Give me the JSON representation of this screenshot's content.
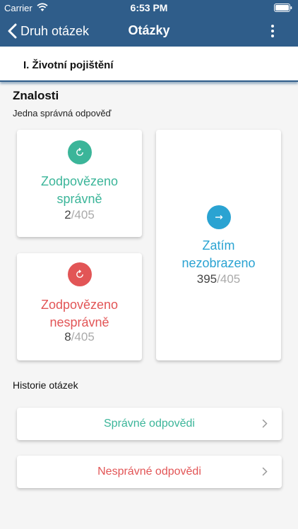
{
  "status_bar": {
    "carrier": "Carrier",
    "time": "6:53 PM"
  },
  "nav": {
    "back_label": "Druh otázek",
    "title": "Otázky"
  },
  "category": {
    "title": "I. Životní pojištění"
  },
  "section": {
    "title": "Znalosti",
    "subtitle": "Jedna správná odpověď"
  },
  "cards": {
    "correct": {
      "label_line1": "Zodpovězeno",
      "label_line2": "správně",
      "count": "2",
      "total": "/405"
    },
    "wrong": {
      "label_line1": "Zodpovězeno",
      "label_line2": "nesprávně",
      "count": "8",
      "total": "/405"
    },
    "unseen": {
      "label_line1": "Zatím",
      "label_line2": "nezobrazeno",
      "count": "395",
      "total": "/405"
    }
  },
  "history": {
    "title": "Historie otázek",
    "correct_label": "Správné odpovědi",
    "wrong_label": "Nesprávné odpovědi"
  },
  "colors": {
    "nav_bg": "#2f5d8a",
    "correct": "#3bb599",
    "wrong": "#e25556",
    "unseen": "#2aa3d2"
  },
  "icons": {
    "back": "chevron-left-icon",
    "more": "more-vertical-icon",
    "correct": "refresh-icon",
    "wrong": "refresh-icon",
    "unseen": "arrow-right-icon",
    "history": "chevron-right-icon"
  }
}
